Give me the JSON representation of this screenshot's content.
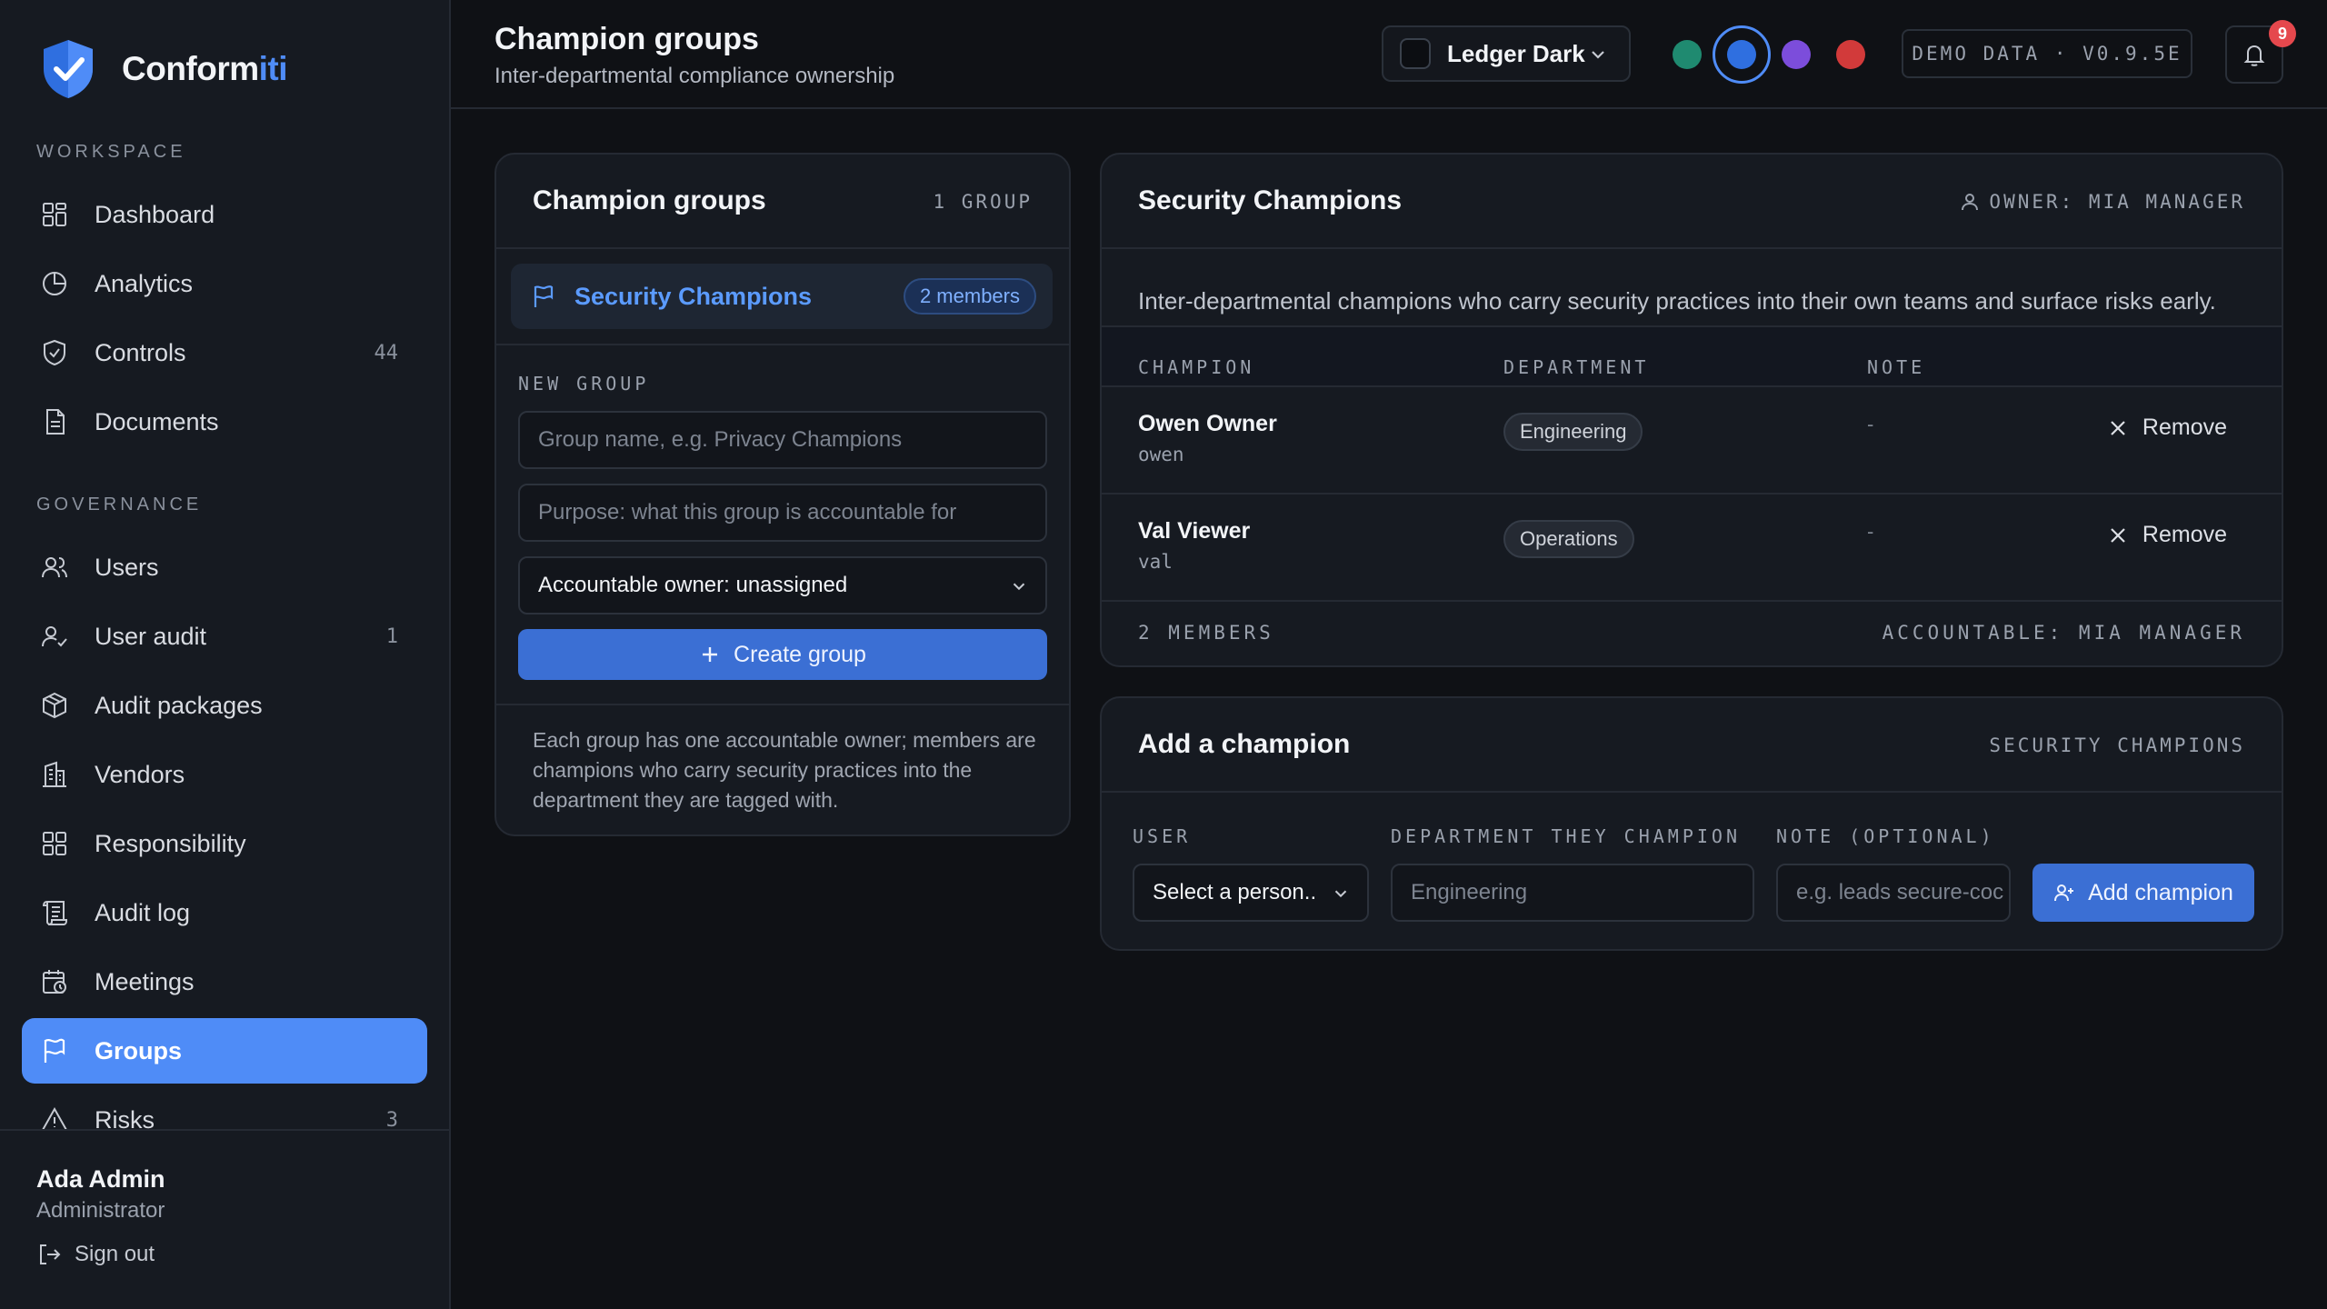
{
  "app": {
    "name_main": "Conform",
    "name_accent": "iti"
  },
  "sidebar": {
    "workspace_label": "WORKSPACE",
    "governance_label": "GOVERNANCE",
    "workspace_items": [
      {
        "label": "Dashboard",
        "icon": "dashboard-icon",
        "count": ""
      },
      {
        "label": "Analytics",
        "icon": "analytics-icon",
        "count": ""
      },
      {
        "label": "Controls",
        "icon": "shield-icon",
        "count": "44"
      },
      {
        "label": "Documents",
        "icon": "document-icon",
        "count": ""
      }
    ],
    "governance_items": [
      {
        "label": "Users",
        "icon": "users-icon",
        "count": ""
      },
      {
        "label": "User audit",
        "icon": "user-check-icon",
        "count": "1"
      },
      {
        "label": "Audit packages",
        "icon": "package-icon",
        "count": ""
      },
      {
        "label": "Vendors",
        "icon": "building-icon",
        "count": ""
      },
      {
        "label": "Responsibility",
        "icon": "grid-icon",
        "count": ""
      },
      {
        "label": "Audit log",
        "icon": "scroll-icon",
        "count": ""
      },
      {
        "label": "Meetings",
        "icon": "calendar-icon",
        "count": ""
      },
      {
        "label": "Groups",
        "icon": "flag-icon",
        "count": "",
        "active": true
      },
      {
        "label": "Risks",
        "icon": "warning-icon",
        "count": "3"
      }
    ],
    "user": {
      "name": "Ada Admin",
      "role": "Administrator",
      "signout": "Sign out"
    }
  },
  "header": {
    "title": "Champion groups",
    "subtitle": "Inter-departmental compliance ownership",
    "theme": "Ledger Dark",
    "swatches": [
      "#1f8a70",
      "#2f6fe0",
      "#7c4ddb",
      "#d23a3a"
    ],
    "version": "DEMO DATA · V0.9.5E",
    "notifications": "9"
  },
  "groups_panel": {
    "title": "Champion groups",
    "count": "1 GROUP",
    "group": {
      "name": "Security Champions",
      "members": "2 members"
    },
    "new_group_label": "NEW GROUP",
    "name_placeholder": "Group name, e.g. Privacy Champions",
    "purpose_placeholder": "Purpose: what this group is accountable for",
    "owner_select": "Accountable owner: unassigned",
    "create_label": "Create group",
    "help": "Each group has one accountable owner; members are champions who carry security practices into the department they are tagged with."
  },
  "detail": {
    "title": "Security Champions",
    "owner": "OWNER: MIA MANAGER",
    "description": "Inter-departmental champions who carry security practices into their own teams and surface risks early.",
    "columns": [
      "CHAMPION",
      "DEPARTMENT",
      "NOTE"
    ],
    "rows": [
      {
        "name": "Owen Owner",
        "handle": "owen",
        "department": "Engineering",
        "note": "-",
        "action": "Remove"
      },
      {
        "name": "Val Viewer",
        "handle": "val",
        "department": "Operations",
        "note": "-",
        "action": "Remove"
      }
    ],
    "footer_count": "2 MEMBERS",
    "footer_owner": "ACCOUNTABLE: MIA MANAGER"
  },
  "add_champion": {
    "title": "Add a champion",
    "group": "SECURITY CHAMPIONS",
    "user_label": "USER",
    "dept_label": "DEPARTMENT THEY CHAMPION",
    "note_label": "NOTE (OPTIONAL)",
    "user_select": "Select a person..",
    "dept_placeholder": "Engineering",
    "note_placeholder": "e.g. leads secure-coc",
    "submit": "Add champion"
  }
}
